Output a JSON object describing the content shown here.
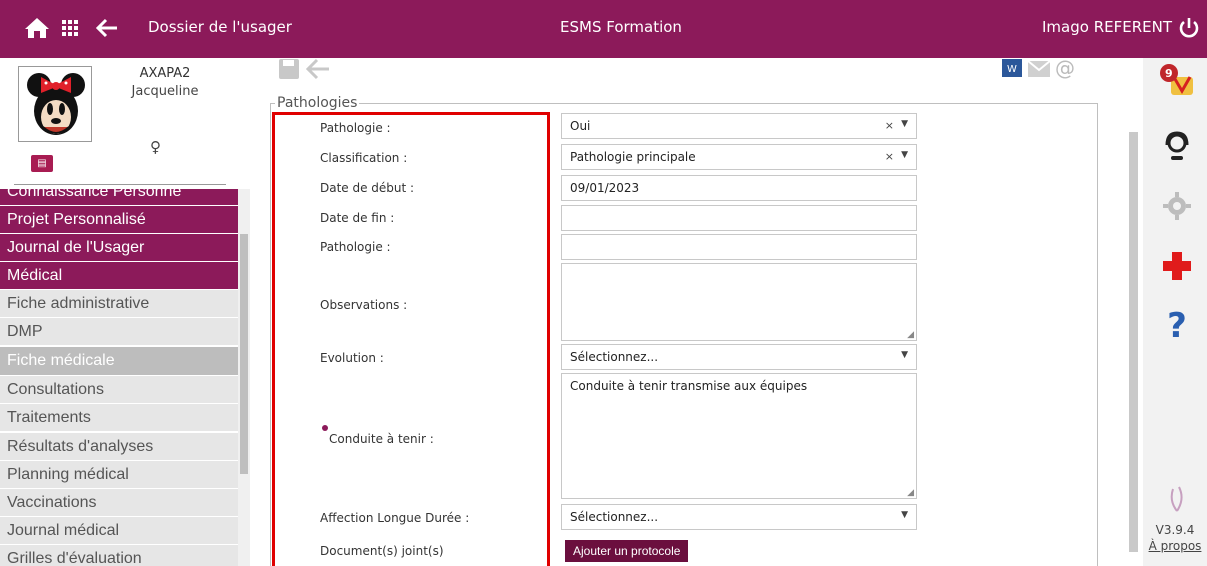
{
  "header": {
    "title_left": "Dossier de l'usager",
    "title_center": "ESMS Formation",
    "user": "Imago REFERENT",
    "home_icon": "home-icon",
    "apps_icon": "grid-icon",
    "back_icon": "arrow-left-icon",
    "power_icon": "power-icon"
  },
  "patient": {
    "name": "AXAPA2",
    "firstname": "Jacqueline",
    "gender_symbol": "♀"
  },
  "sidebar": {
    "items": [
      {
        "label": "Connaissance Personne"
      },
      {
        "label": "Projet Personnalisé"
      },
      {
        "label": "Journal de l'Usager"
      },
      {
        "label": "Médical"
      },
      {
        "label": "Fiche administrative"
      },
      {
        "label": "DMP"
      },
      {
        "label": "Fiche médicale"
      },
      {
        "label": "Consultations"
      },
      {
        "label": "Traitements"
      },
      {
        "label": "Résultats d'analyses"
      },
      {
        "label": "Planning médical"
      },
      {
        "label": "Vaccinations"
      },
      {
        "label": "Journal médical"
      },
      {
        "label": "Grilles d'évaluation"
      }
    ]
  },
  "form": {
    "section_title": "Pathologies",
    "fields": {
      "pathologie": {
        "label": "Pathologie :",
        "value": "Oui"
      },
      "classification": {
        "label": "Classification :",
        "value": "Pathologie principale"
      },
      "date_debut": {
        "label": "Date de début :",
        "value": "09/01/2023"
      },
      "date_fin": {
        "label": "Date de fin :",
        "value": ""
      },
      "pathologie2": {
        "label": "Pathologie :",
        "value": ""
      },
      "observations": {
        "label": "Observations :",
        "value": ""
      },
      "evolution": {
        "label": "Evolution :",
        "value": "Sélectionnez..."
      },
      "conduite": {
        "label": "Conduite à tenir :",
        "value": "Conduite à tenir transmise aux équipes"
      },
      "ald": {
        "label": "Affection Longue Durée :",
        "value": "Sélectionnez..."
      },
      "documents": {
        "label": "Document(s) joint(s)"
      }
    },
    "add_protocol_label": "Ajouter un protocole",
    "clear_glyph": "×",
    "caret_glyph": "▼"
  },
  "right": {
    "notifications_count": "9",
    "version": "V3.9.4",
    "about": "À propos"
  },
  "colors": {
    "brand": "#8c1a5a",
    "highlight": "#e00000",
    "active_menu": "#bdbdbd"
  }
}
